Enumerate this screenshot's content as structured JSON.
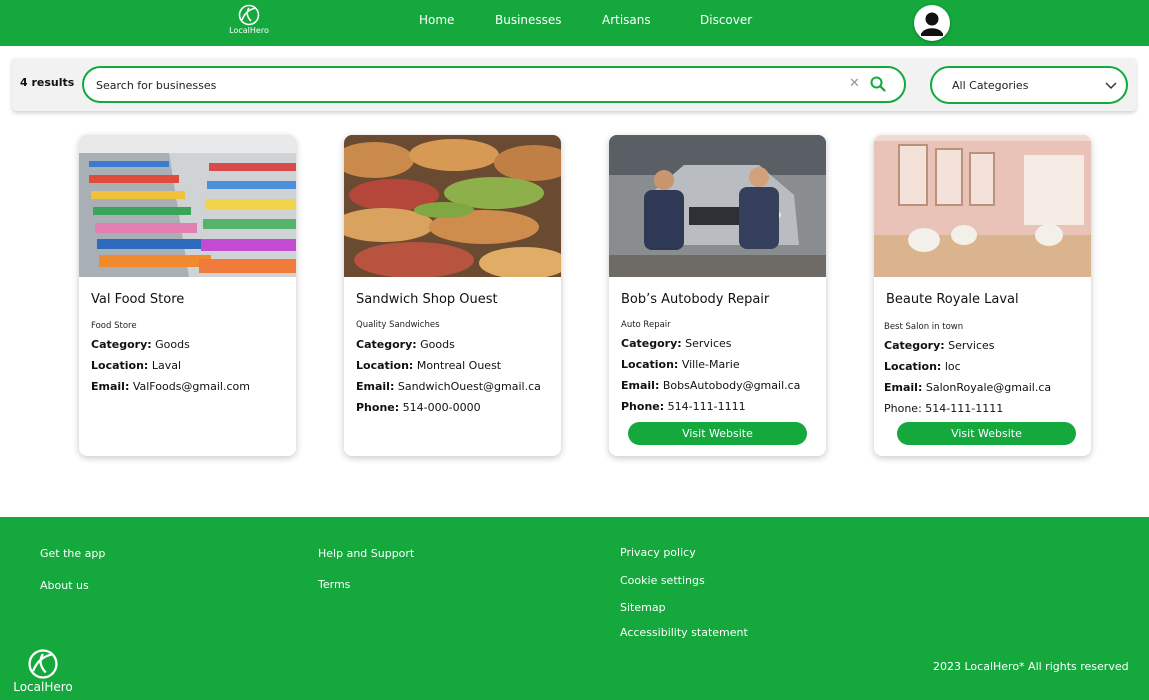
{
  "brand": {
    "name": "LocalHero"
  },
  "nav": {
    "home": "Home",
    "businesses": "Businesses",
    "artisans": "Artisans",
    "discover": "Discover"
  },
  "search": {
    "results_count": "4 results",
    "placeholder": "Search for businesses",
    "category_selected": "All Categories"
  },
  "cards": [
    {
      "title": "Val Food Store",
      "subtitle": "Food Store",
      "category_label": "Category:",
      "category": "Goods",
      "location_label": "Location:",
      "location": "Laval",
      "email_label": "Email:",
      "email": "ValFoods@gmail.com"
    },
    {
      "title": "Sandwich Shop Ouest",
      "subtitle": "Quality Sandwiches",
      "category_label": "Category:",
      "category": "Goods",
      "location_label": "Location:",
      "location": "Montreal Ouest",
      "email_label": "Email:",
      "email": "SandwichOuest@gmail.ca",
      "phone_label": "Phone:",
      "phone": "514-000-0000"
    },
    {
      "title": "Bob’s Autobody Repair",
      "subtitle": "Auto Repair",
      "category_label": "Category:",
      "category": "Services",
      "location_label": "Location:",
      "location": "Ville-Marie",
      "email_label": "Email:",
      "email": "BobsAutobody@gmail.ca",
      "phone_label": "Phone:",
      "phone": "514-111-1111",
      "button": "Visit Website"
    },
    {
      "title": "Beaute Royale Laval",
      "subtitle": "Best Salon in town",
      "category_label": "Category:",
      "category": "Services",
      "location_label": "Location:",
      "location": "loc",
      "email_label": "Email:",
      "email": "SalonRoyale@gmail.ca",
      "phone_label": "Phone:",
      "phone": "514-111-1111",
      "button": "Visit Website"
    }
  ],
  "footer": {
    "get_app": "Get the app",
    "about": "About us",
    "help": "Help and Support",
    "terms": "Terms",
    "privacy": "Privacy policy",
    "cookies": "Cookie settings",
    "sitemap": "Sitemap",
    "accessibility": "Accessibility statement",
    "copyright": "2023 LocalHero* All rights reserved"
  },
  "colors": {
    "brand_green": "#14a83d",
    "card_bg": "#ffffff",
    "searchbar_bg": "#f2f2f2"
  },
  "icons": [
    "leaf-logo-icon",
    "user-avatar-icon",
    "search-icon",
    "close-icon",
    "chevron-down-icon"
  ]
}
